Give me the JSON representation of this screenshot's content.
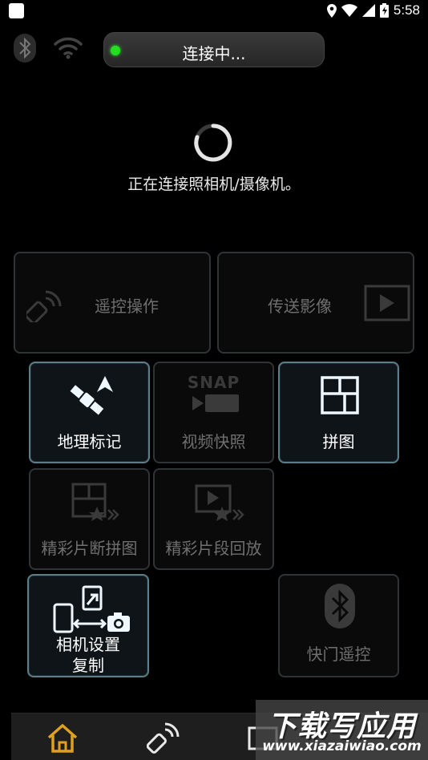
{
  "status_bar": {
    "time": "5:58"
  },
  "connection": {
    "status_text": "连接中...",
    "message": "正在连接照相机/摄像机。"
  },
  "tiles": {
    "remote": {
      "label": "遥控操作"
    },
    "transfer": {
      "label": "传送影像"
    },
    "geotag": {
      "label": "地理标记"
    },
    "snap": {
      "label": "视频快照",
      "icon_text": "SNAP"
    },
    "collage": {
      "label": "拼图"
    },
    "highlight_collage": {
      "label": "精彩片断拼图"
    },
    "highlight_playback": {
      "label": "精彩片段回放"
    },
    "copy_settings": {
      "label_line1": "相机设置",
      "label_line2": "复制"
    },
    "shutter_remote": {
      "label": "快门遥控"
    }
  },
  "watermark": {
    "title": "下载写应用",
    "url": "www.xiazaiwiao.com"
  },
  "colors": {
    "accent_active_border": "#5d7e88",
    "status_dot": "#20e020",
    "home_icon": "#e0a020"
  }
}
